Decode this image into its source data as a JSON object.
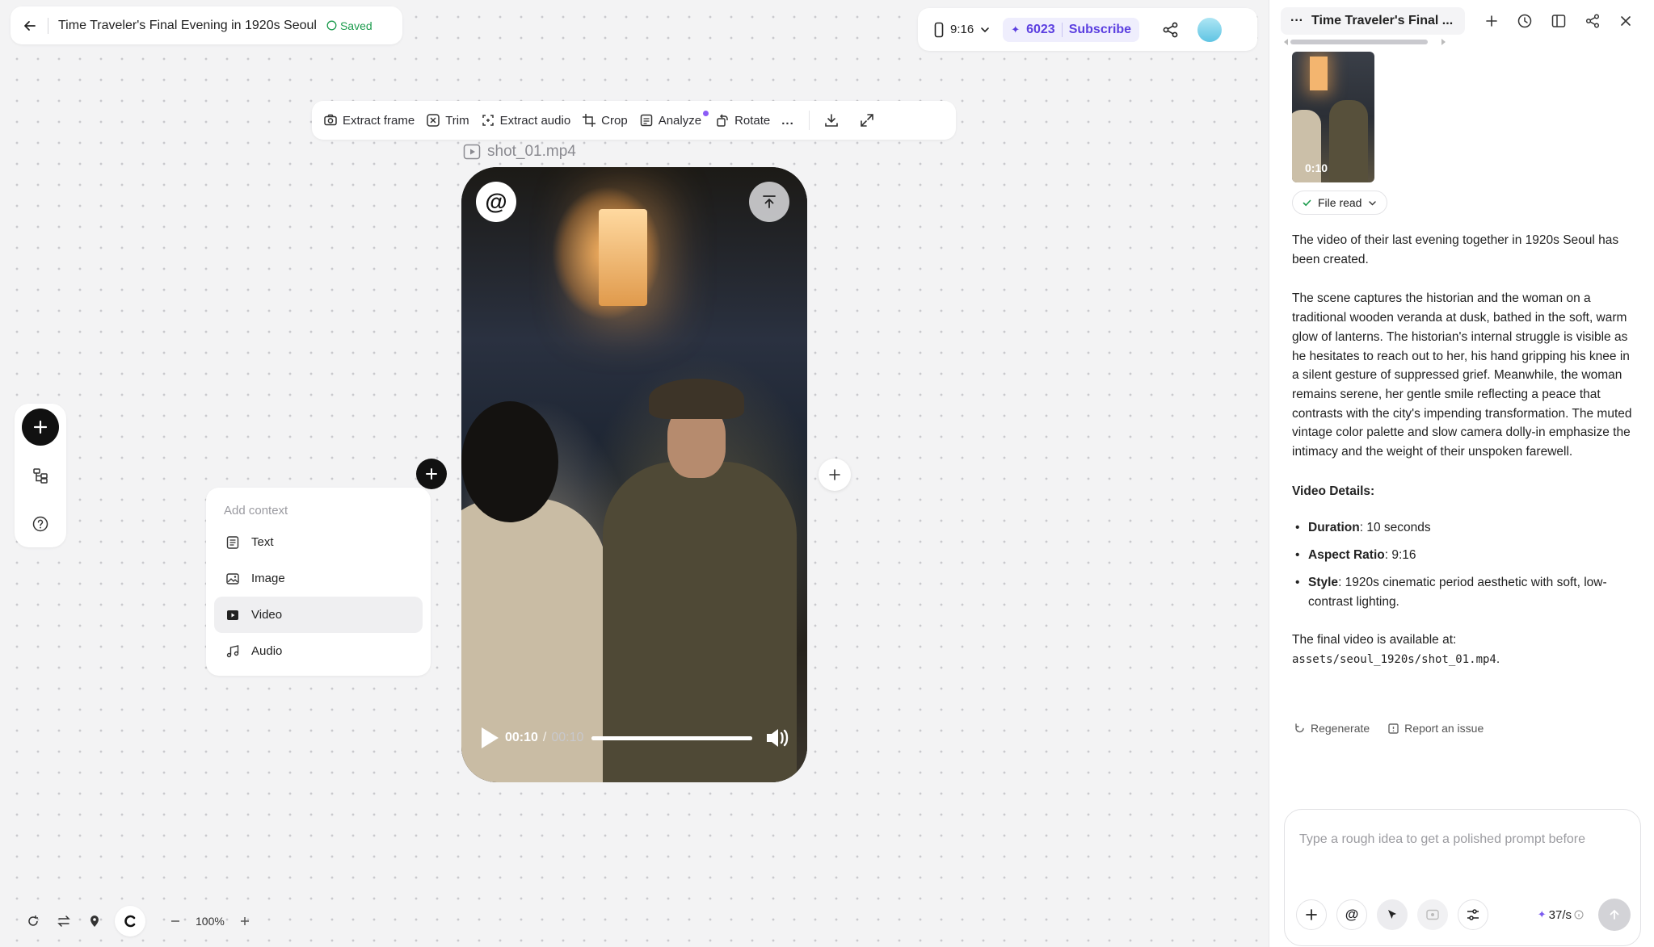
{
  "header": {
    "title": "Time Traveler's Final Evening in 1920s Seoul",
    "saved": "Saved"
  },
  "topbar": {
    "ratio": "9:16",
    "credits": "6023",
    "subscribe": "Subscribe"
  },
  "toolbar": {
    "extract_frame": "Extract frame",
    "trim": "Trim",
    "extract_audio": "Extract audio",
    "crop": "Crop",
    "analyze": "Analyze",
    "rotate": "Rotate",
    "more": "..."
  },
  "video": {
    "filename": "shot_01.mp4",
    "mention": "@",
    "current_time": "00:10",
    "time_separator": "/",
    "duration": "00:10",
    "progress_fraction": 1.0
  },
  "context_menu": {
    "heading": "Add context",
    "items": [
      {
        "label": "Text",
        "icon": "text-icon"
      },
      {
        "label": "Image",
        "icon": "image-icon"
      },
      {
        "label": "Video",
        "icon": "video-icon"
      },
      {
        "label": "Audio",
        "icon": "audio-icon"
      }
    ]
  },
  "zoom": {
    "level": "100%"
  },
  "panel": {
    "title": "Time Traveler's Final ...",
    "thumb_time": "0:10",
    "file_read": "File read",
    "intro": "The video of their last evening together in 1920s Seoul has been created.",
    "description": "The scene captures the historian and the woman on a traditional wooden veranda at dusk, bathed in the soft, warm glow of lanterns. The historian's internal struggle is visible as he hesitates to reach out to her, his hand gripping his knee in a silent gesture of suppressed grief. Meanwhile, the woman remains serene, her gentle smile reflecting a peace that contrasts with the city's impending transformation. The muted vintage color palette and slow camera dolly-in emphasize the intimacy and the weight of their unspoken farewell.",
    "details_heading": "Video Details:",
    "details": [
      {
        "label": "Duration",
        "value": ": 10 seconds"
      },
      {
        "label": "Aspect Ratio",
        "value": ": 9:16"
      },
      {
        "label": "Style",
        "value": ": 1920s cinematic period aesthetic with soft, low-contrast lighting."
      }
    ],
    "final_prefix": "The final video is available at: ",
    "final_path": "assets/seoul_1920s/shot_01.mp4",
    "final_suffix": ".",
    "regenerate": "Regenerate",
    "report": "Report an issue",
    "composer_placeholder": "Type a rough idea to get a polished prompt before",
    "mention": "@",
    "rate": "37/s"
  },
  "colors": {
    "accent": "#5b3fe0",
    "saved": "#1c9b4d",
    "dark": "#111111"
  }
}
